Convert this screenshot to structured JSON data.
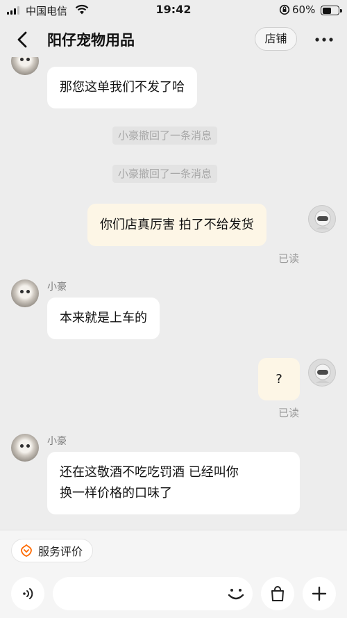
{
  "status_bar": {
    "carrier": "中国电信",
    "time": "19:42",
    "battery": "60%",
    "battery_level": 0.6
  },
  "nav": {
    "back_icon": "chevron-left-icon",
    "title": "阳仔宠物用品",
    "shop_button": "店铺",
    "more_icon": "more-horizontal-icon"
  },
  "chat": {
    "messages": [
      {
        "side": "left",
        "text": "那您这单我们不发了哈"
      },
      {
        "type": "system",
        "text": "小豪撤回了一条消息"
      },
      {
        "type": "system",
        "text": "小豪撤回了一条消息"
      },
      {
        "side": "right",
        "text": "你们店真厉害 拍了不给发货",
        "status": "已读"
      },
      {
        "side": "left",
        "sender": "小豪",
        "text": "本来就是上车的"
      },
      {
        "side": "right",
        "text": "?",
        "status": "已读"
      },
      {
        "side": "left",
        "sender": "小豪",
        "lines": [
          "还在这敬酒不吃吃罚酒  已经叫你",
          "换一样价格的口味了"
        ]
      }
    ]
  },
  "bottom": {
    "service_button": "服务评价",
    "service_icon": "flower-badge-icon",
    "voice_icon": "voice-icon",
    "emoji_icon": "smile-icon",
    "bag_icon": "shopping-bag-icon",
    "plus_icon": "plus-icon"
  },
  "colors": {
    "background": "#ededed",
    "bubble_left": "#ffffff",
    "bubble_right": "#fdf6e6",
    "accent_orange": "#ff6a00"
  }
}
